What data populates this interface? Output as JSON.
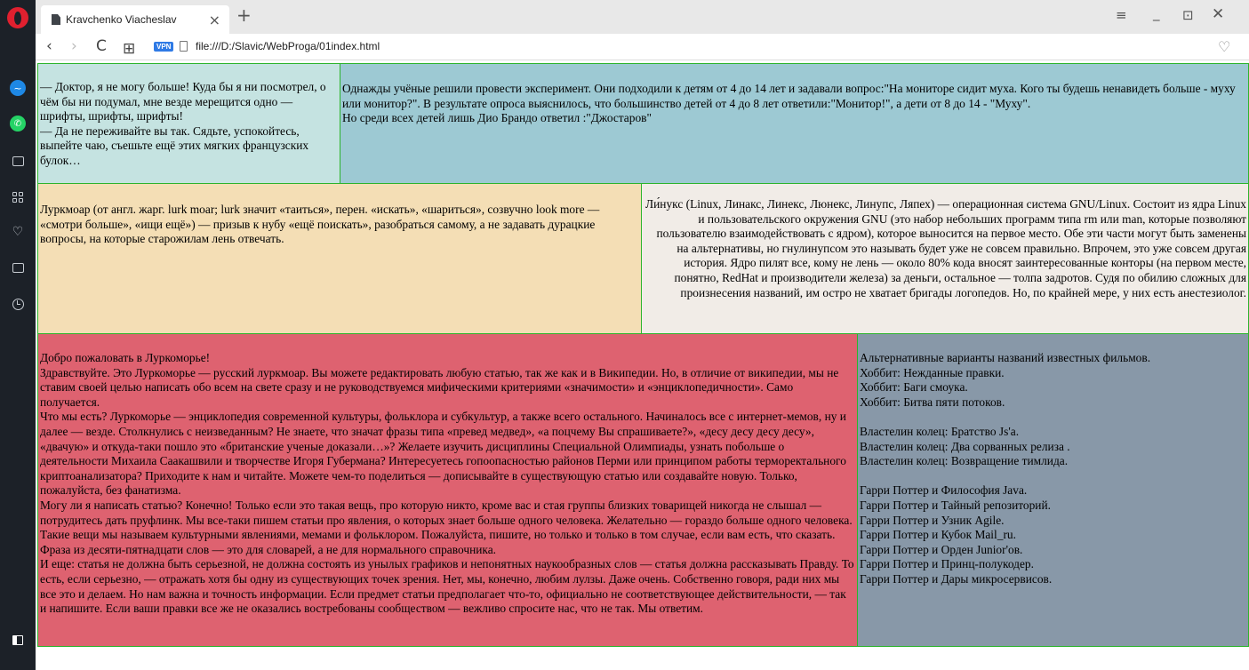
{
  "browser": {
    "tab_title": "Kravchenko Viacheslav",
    "tab_close": "×",
    "new_tab": "+",
    "url": "file:///D:/Slavic/WebProga/01index.html",
    "vpn_label": "VPN",
    "nav": {
      "back": "‹",
      "forward": "›",
      "reload": "C",
      "speed_dial": "⊞"
    },
    "window": {
      "filter": "≡",
      "minimize": "_",
      "maximize": "⊡",
      "close": "✕"
    },
    "favorite": "♡"
  },
  "sidebar": {
    "icons": [
      "opera-logo",
      "messenger-icon",
      "whatsapp-icon",
      "camera-icon",
      "speed-dial-icon",
      "heart-icon",
      "news-icon",
      "history-icon",
      "panel-toggle-icon"
    ]
  },
  "content": {
    "joke_doctor": [
      "— Доктор, я не могу больше! Куда бы я ни посмотрел, о чём бы ни подумал, мне везде мерещится одно — шрифты, шрифты, шрифты!",
      "— Да не переживайте вы так. Сядьте, успокойтесь, выпейте чаю, съешьте ещё этих мягких французских булок…"
    ],
    "experiment": [
      "Однажды учёные решили провести эксперимент. Они подходили к детям от 4 до 14 лет и задавали вопрос:\"На мониторе сидит муха. Кого ты будешь ненавидеть больше - муху или монитор?\". В результате опроса выяснилось, что большинство детей от 4 до 8 лет ответили:\"Монитор!\", а дети от 8 до 14 - \"Муху\".",
      "Но среди всех детей лишь Дио Брандо ответил :\"Джостаров\""
    ],
    "lurkmore": "Луркмоар (от англ. жарг. lurk moar; lurk значит «таиться», перен. «искать», «шариться», созвучно look more — «смотри больше», «ищи ещё») — призыв к нубу «ещё поискать», разобраться самому, а не задавать дурацкие вопросы, на которые старожилам лень отвечать.",
    "linux": "Ли́нукс (Linux, Линакс, Линекс, Люнекс, Линупс, Ляпех) — операционная система GNU/Linux. Состоит из ядра Linux и пользовательского окружения GNU (это набор небольших программ типа rm или man, которые позволяют пользователю взаимодействовать с ядром), которое выносится на первое место. Обе эти части могут быть заменены на альтернативы, но гнулинупсом это называть будет уже не совсем правильно. Впрочем, это уже совсем другая история. Ядро пилят все, кому не лень — около 80% кода вносят заинтересованные конторы (на первом месте, понятно, RedHat и производители железа) за деньги, остальное — толпа задротов. Судя по обилию сложных для произнесения названий, им остро не хватает бригады логопедов. Но, по крайней мере, у них есть анестезиолог.",
    "welcome": [
      "Добро пожаловать в Луркоморье!",
      "Здравствуйте. Это Луркоморье — русский луркмоар. Вы можете редактировать любую статью, так же как и в Википедии. Но, в отличие от википедии, мы не ставим своей целью написать обо всем на свете сразу и не руководствуемся мифическими критериями «значимости» и «энциклопедичности». Само получается.",
      "Что мы есть? Луркоморье — энциклопедия современной культуры, фольклора и субкультур, а также всего остального. Начиналось все с интернет-мемов, ну и далее — везде. Столкнулись с неизведанным? Не знаете, что значат фразы типа «превед медвед», «а поцчему Вы спрашиваете?», «десу десу десу десу», «двачую» и откуда-таки пошло это «британские ученые доказали…»? Желаете изучить дисциплины Специальной Олимпиады, узнать побольше о деятельности Михаила Саакашвили и творчестве Игоря Губермана? Интересуетесь гопоопасностью районов Перми или принципом работы терморектального криптоанализатора? Приходите к нам и читайте. Можете чем-то поделиться — дописывайте в существующую статью или создавайте новую. Только, пожалуйста, без фанатизма.",
      "Могу ли я написать статью? Конечно! Только если это такая вещь, про которую никто, кроме вас и стая группы близких товарищей никогда не слышал — потрудитесь дать пруфлинк. Мы все-таки пишем статьи про явления, о которых знает больше одного человека. Желательно — гораздо больше одного человека. Такие вещи мы называем культурными явлениями, мемами и фольклором. Пожалуйста, пишите, но только и только в том случае, если вам есть, что сказать. Фраза из десяти-пятнадцати слов — это для словарей, а не для нормального справочника.",
      "И еще: статья не должна быть серьезной, не должна состоять из унылых графиков и непонятных наукообразных слов — статья должна рассказывать Правду. То есть, если серьезно, — отражать хотя бы одну из существующих точек зрения. Нет, мы, конечно, любим лулзы. Даже очень. Собственно говоря, ради них мы все это и делаем. Но нам важна и точность информации. Если предмет статьи предполагает что-то, официально не соответствующее действительности, — так и напишите. Если ваши правки все же не оказались востребованы сообществом — вежливо спросите нас, что не так. Мы ответим."
    ],
    "films": [
      "Альтернативные варианты названий известных фильмов.",
      "Хоббит: Нежданные правки.",
      "Хоббит: Баги смоука.",
      "Хоббит: Битва пяти потоков.",
      "",
      "Властелин колец: Братство Js'a.",
      "Властелин колец: Два сорванных релиза .",
      "Властелин колец: Возвращение тимлида.",
      "",
      "Гарри Поттер и Философия Java.",
      "Гарри Поттер и Тайный репозиторий.",
      "Гарри Поттер и Узник Agile.",
      "Гарри Поттер и Кубок Mail_ru.",
      "Гарри Поттер и Орден Junior'ов.",
      "Гарри Поттер и Принц-полукодер.",
      "Гарри Поттер и Дары микросервисов."
    ]
  }
}
